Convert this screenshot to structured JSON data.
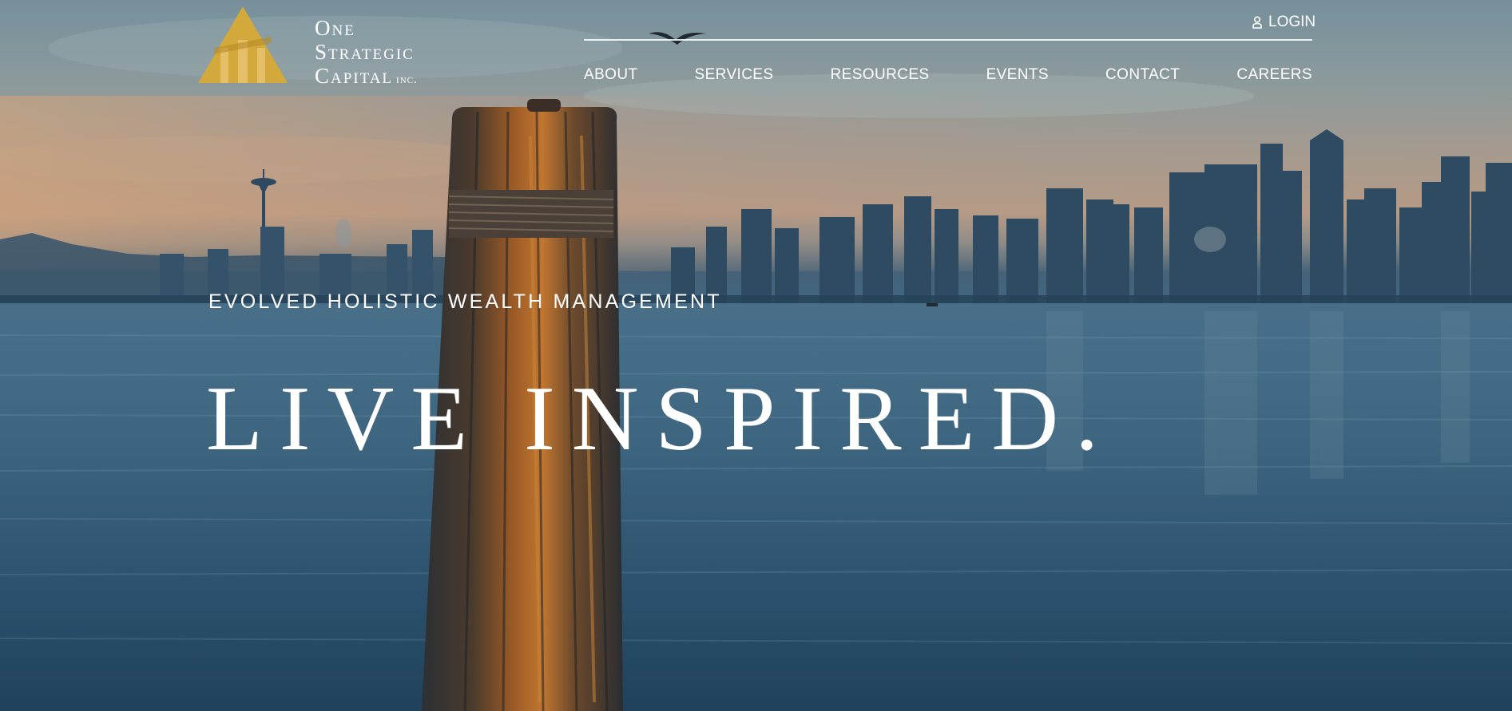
{
  "logo": {
    "line1": "One",
    "line2": "Strategic",
    "line3": "Capital",
    "suffix": "inc.",
    "mark_color": "#d4a93c"
  },
  "header": {
    "login_label": "LOGIN",
    "login_icon": "user-icon"
  },
  "nav": {
    "items": [
      {
        "label": "ABOUT"
      },
      {
        "label": "SERVICES"
      },
      {
        "label": "RESOURCES"
      },
      {
        "label": "EVENTS"
      },
      {
        "label": "CONTACT"
      },
      {
        "label": "CAREERS"
      }
    ]
  },
  "hero": {
    "tagline": "EVOLVED HOLISTIC WEALTH MANAGEMENT",
    "headline": "LIVE INSPIRED."
  }
}
